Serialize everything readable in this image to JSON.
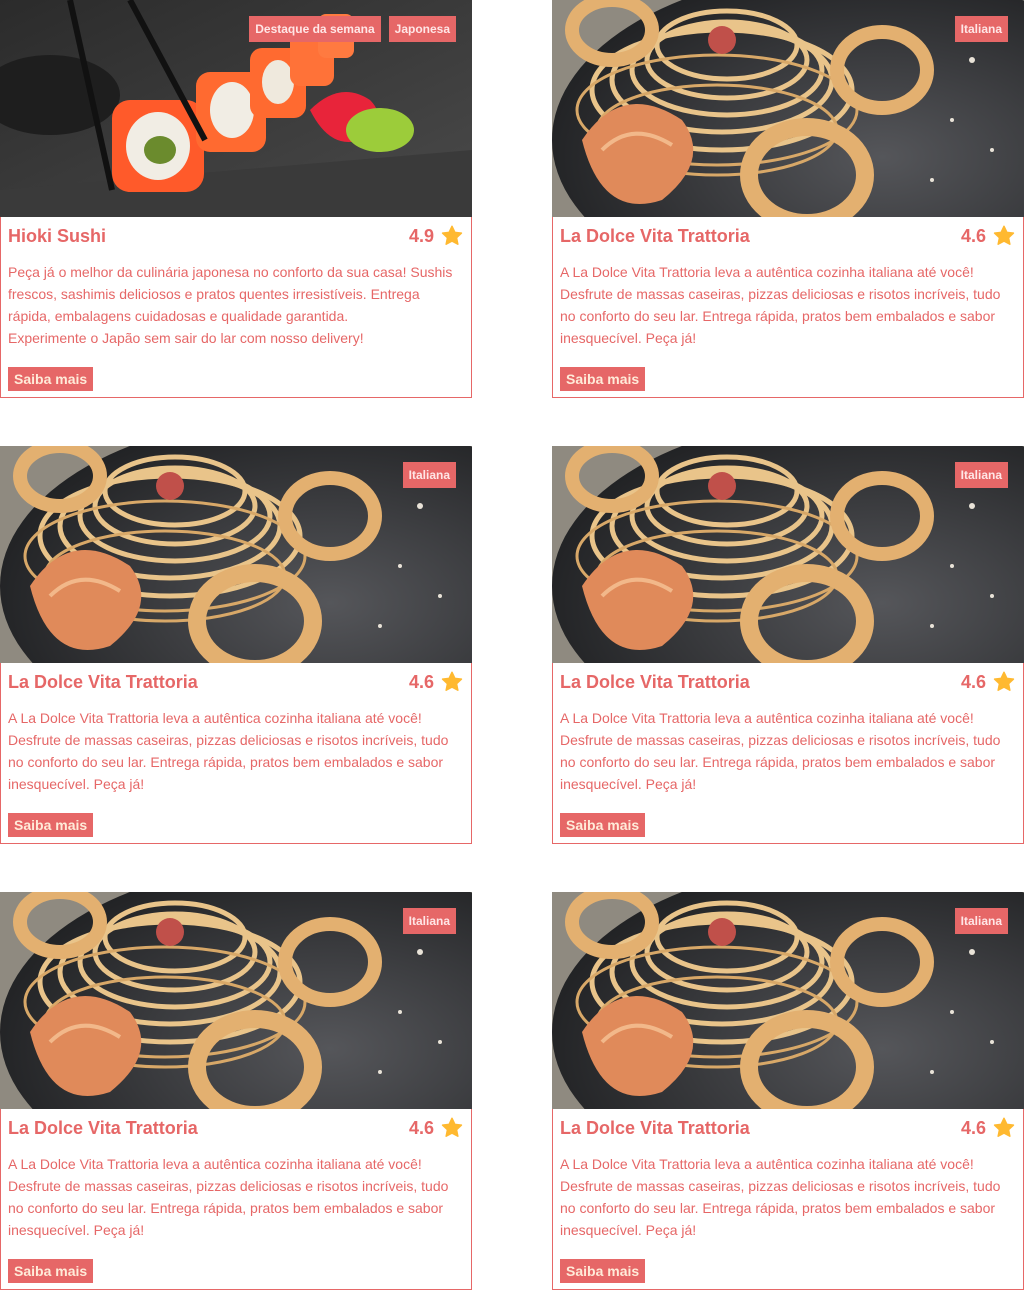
{
  "cards": [
    {
      "title": "Hioki Sushi",
      "rating": "4.9",
      "tags": [
        "Destaque da semana",
        "Japonesa"
      ],
      "description": "Peça já o melhor da culinária japonesa no conforto da sua casa! Sushis frescos, sashimis deliciosos e pratos quentes irresistíveis. Entrega rápida, embalagens cuidadosas e qualidade garantida.\nExperimente o Japão sem sair do lar com nosso delivery!",
      "button": "Saiba mais",
      "image": "sushi"
    },
    {
      "title": "La Dolce Vita Trattoria",
      "rating": "4.6",
      "tags": [
        "Italiana"
      ],
      "description": "A La Dolce Vita Trattoria leva a autêntica cozinha italiana até você! Desfrute de massas caseiras, pizzas deliciosas e risotos incríveis, tudo no conforto do seu lar. Entrega rápida, pratos bem embalados e sabor inesquecível. Peça já!",
      "button": "Saiba mais",
      "image": "pasta"
    },
    {
      "title": "La Dolce Vita Trattoria",
      "rating": "4.6",
      "tags": [
        "Italiana"
      ],
      "description": "A La Dolce Vita Trattoria leva a autêntica cozinha italiana até você! Desfrute de massas caseiras, pizzas deliciosas e risotos incríveis, tudo no conforto do seu lar. Entrega rápida, pratos bem embalados e sabor inesquecível. Peça já!",
      "button": "Saiba mais",
      "image": "pasta"
    },
    {
      "title": "La Dolce Vita Trattoria",
      "rating": "4.6",
      "tags": [
        "Italiana"
      ],
      "description": "A La Dolce Vita Trattoria leva a autêntica cozinha italiana até você! Desfrute de massas caseiras, pizzas deliciosas e risotos incríveis, tudo no conforto do seu lar. Entrega rápida, pratos bem embalados e sabor inesquecível. Peça já!",
      "button": "Saiba mais",
      "image": "pasta"
    },
    {
      "title": "La Dolce Vita Trattoria",
      "rating": "4.6",
      "tags": [
        "Italiana"
      ],
      "description": "A La Dolce Vita Trattoria leva a autêntica cozinha italiana até você! Desfrute de massas caseiras, pizzas deliciosas e risotos incríveis, tudo no conforto do seu lar. Entrega rápida, pratos bem embalados e sabor inesquecível. Peça já!",
      "button": "Saiba mais",
      "image": "pasta"
    },
    {
      "title": "La Dolce Vita Trattoria",
      "rating": "4.6",
      "tags": [
        "Italiana"
      ],
      "description": "A La Dolce Vita Trattoria leva a autêntica cozinha italiana até você! Desfrute de massas caseiras, pizzas deliciosas e risotos incríveis, tudo no conforto do seu lar. Entrega rápida, pratos bem embalados e sabor inesquecível. Peça já!",
      "button": "Saiba mais",
      "image": "pasta"
    }
  ],
  "colors": {
    "accent": "#e66767",
    "star": "#ffb930",
    "button_text": "#ffebd9"
  },
  "icons": {
    "rating": "star-icon"
  }
}
